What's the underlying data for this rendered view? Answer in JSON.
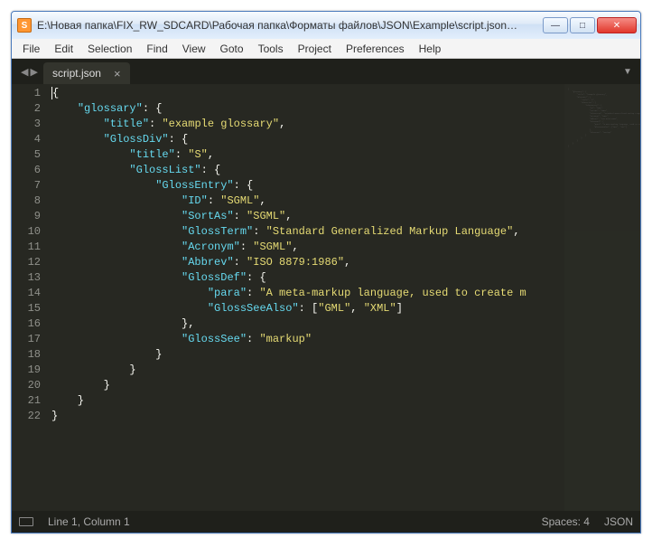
{
  "window": {
    "app_icon_letter": "S",
    "title": "E:\\Новая папка\\FIX_RW_SDCARD\\Рабочая папка\\Форматы файлов\\JSON\\Example\\script.json…",
    "min_glyph": "—",
    "max_glyph": "□",
    "close_glyph": "✕"
  },
  "menu": {
    "items": [
      "File",
      "Edit",
      "Selection",
      "Find",
      "View",
      "Goto",
      "Tools",
      "Project",
      "Preferences",
      "Help"
    ]
  },
  "tabbar": {
    "nav_prev": "◀",
    "nav_next": "▶",
    "tab_name": "script.json",
    "close_glyph": "×",
    "dropdown_glyph": "▼"
  },
  "code_lines": [
    {
      "n": "1",
      "t": "{"
    },
    {
      "n": "2",
      "t": "    \"glossary\": {"
    },
    {
      "n": "3",
      "t": "        \"title\": \"example glossary\","
    },
    {
      "n": "4",
      "t": "        \"GlossDiv\": {"
    },
    {
      "n": "5",
      "t": "            \"title\": \"S\","
    },
    {
      "n": "6",
      "t": "            \"GlossList\": {"
    },
    {
      "n": "7",
      "t": "                \"GlossEntry\": {"
    },
    {
      "n": "8",
      "t": "                    \"ID\": \"SGML\","
    },
    {
      "n": "9",
      "t": "                    \"SortAs\": \"SGML\","
    },
    {
      "n": "10",
      "t": "                    \"GlossTerm\": \"Standard Generalized Markup Language\","
    },
    {
      "n": "11",
      "t": "                    \"Acronym\": \"SGML\","
    },
    {
      "n": "12",
      "t": "                    \"Abbrev\": \"ISO 8879:1986\","
    },
    {
      "n": "13",
      "t": "                    \"GlossDef\": {"
    },
    {
      "n": "14",
      "t": "                        \"para\": \"A meta-markup language, used to create m"
    },
    {
      "n": "15",
      "t": "                        \"GlossSeeAlso\": [\"GML\", \"XML\"]"
    },
    {
      "n": "16",
      "t": "                    },"
    },
    {
      "n": "17",
      "t": "                    \"GlossSee\": \"markup\""
    },
    {
      "n": "18",
      "t": "                }"
    },
    {
      "n": "19",
      "t": "            }"
    },
    {
      "n": "20",
      "t": "        }"
    },
    {
      "n": "21",
      "t": "    }"
    },
    {
      "n": "22",
      "t": "}"
    }
  ],
  "statusbar": {
    "position": "Line 1, Column 1",
    "spaces": "Spaces: 4",
    "syntax": "JSON"
  }
}
